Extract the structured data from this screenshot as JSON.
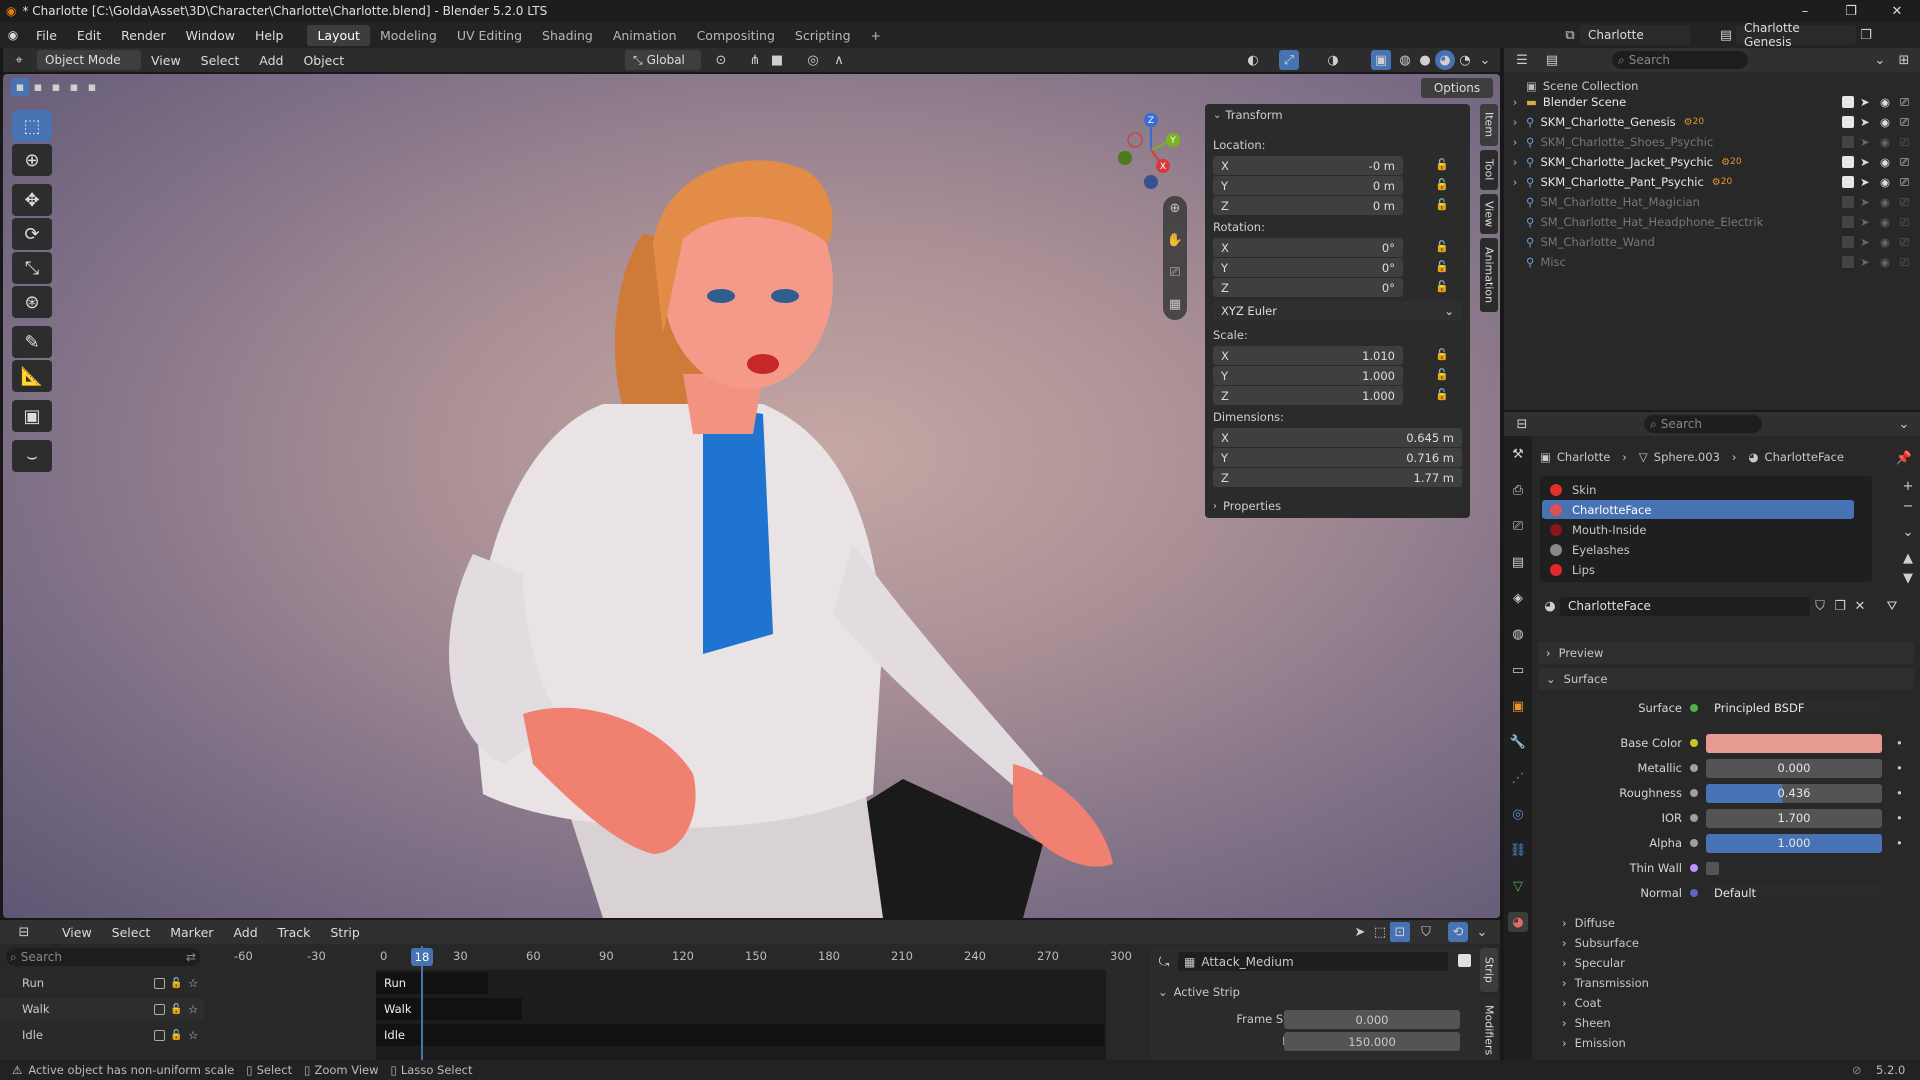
{
  "window": {
    "title": "* Charlotte [C:\\Golda\\Asset\\3D\\Character\\Charlotte\\Charlotte.blend] - Blender 5.2.0 LTS",
    "minimize": "–",
    "maximize": "❐",
    "close": "✕"
  },
  "menubar": {
    "menus": [
      "File",
      "Edit",
      "Render",
      "Window",
      "Help"
    ],
    "workspaces": [
      "Layout",
      "Modeling",
      "UV Editing",
      "Shading",
      "Animation",
      "Compositing",
      "Scripting"
    ],
    "active_workspace": "Layout",
    "add_tab": "+",
    "scene": "Charlotte",
    "view_layer": "Charlotte Genesis"
  },
  "viewport_header": {
    "mode": "Object Mode",
    "menus": [
      "View",
      "Select",
      "Add",
      "Object"
    ],
    "orientation": "Global",
    "options": "Options"
  },
  "gizmo": {
    "z": "Z",
    "x": "X",
    "y": "Y"
  },
  "tools": [
    "select-box-icon",
    "cursor-icon",
    "move-icon",
    "rotate-icon",
    "scale-icon",
    "transform-icon",
    "annotate-icon",
    "measure-icon",
    "add-cube-icon",
    "curve-icon"
  ],
  "npanel": {
    "title": "Transform",
    "location_label": "Location:",
    "location": {
      "x": "-0 m",
      "y": "0 m",
      "z": "0 m"
    },
    "rotation_label": "Rotation:",
    "rotation": {
      "x": "0°",
      "y": "0°",
      "z": "0°"
    },
    "rotation_mode": "XYZ Euler",
    "scale_label": "Scale:",
    "scale": {
      "x": "1.010",
      "y": "1.000",
      "z": "1.000"
    },
    "dimensions_label": "Dimensions:",
    "dimensions": {
      "x": "0.645 m",
      "y": "0.716 m",
      "z": "1.77 m"
    },
    "axis": {
      "x": "X",
      "y": "Y",
      "z": "Z"
    },
    "properties": "Properties",
    "tabs": [
      "Item",
      "Tool",
      "View",
      "Animation"
    ]
  },
  "outliner": {
    "search_placeholder": "Search",
    "root": "Scene Collection",
    "items": [
      {
        "name": "Blender Scene",
        "type": "collection",
        "enabled": true
      },
      {
        "name": "SKM_Charlotte_Genesis",
        "type": "armature",
        "enabled": true,
        "badge": "20"
      },
      {
        "name": "SKM_Charlotte_Shoes_Psychic",
        "type": "armature",
        "enabled": false
      },
      {
        "name": "SKM_Charlotte_Jacket_Psychic",
        "type": "armature",
        "enabled": true,
        "badge": "20"
      },
      {
        "name": "SKM_Charlotte_Pant_Psychic",
        "type": "armature",
        "enabled": true,
        "badge": "20"
      },
      {
        "name": "SM_Charlotte_Hat_Magician",
        "type": "mesh",
        "enabled": false
      },
      {
        "name": "SM_Charlotte_Hat_Headphone_Electrik",
        "type": "mesh",
        "enabled": false
      },
      {
        "name": "SM_Charlotte_Wand",
        "type": "mesh",
        "enabled": false
      },
      {
        "name": "Misc",
        "type": "mesh",
        "enabled": false
      }
    ]
  },
  "properties": {
    "search_placeholder": "Search",
    "breadcrumb": [
      "Charlotte",
      "Sphere.003",
      "CharlotteFace"
    ],
    "materials": [
      "Skin",
      "CharlotteFace",
      "Mouth-Inside",
      "Eyelashes",
      "Lips"
    ],
    "active_material": "CharlotteFace",
    "material_name": "CharlotteFace",
    "preview": "Preview",
    "surface_section": "Surface",
    "fields": {
      "surface": {
        "label": "Surface",
        "value": "Principled BSDF"
      },
      "base_color": {
        "label": "Base Color",
        "color": "#e79a92"
      },
      "metallic": {
        "label": "Metallic",
        "value": "0.000",
        "fraction": 0.0
      },
      "roughness": {
        "label": "Roughness",
        "value": "0.436",
        "fraction": 0.436
      },
      "ior": {
        "label": "IOR",
        "value": "1.700"
      },
      "alpha": {
        "label": "Alpha",
        "value": "1.000",
        "fraction": 1.0
      },
      "thin_wall": {
        "label": "Thin Wall"
      },
      "normal": {
        "label": "Normal",
        "value": "Default"
      }
    },
    "subsections": [
      "Diffuse",
      "Subsurface",
      "Specular",
      "Transmission",
      "Coat",
      "Sheen",
      "Emission"
    ]
  },
  "nla": {
    "menus": [
      "View",
      "Select",
      "Marker",
      "Add",
      "Track",
      "Strip"
    ],
    "search_placeholder": "Search",
    "ruler": [
      "-60",
      "-30",
      "0",
      "30",
      "60",
      "90",
      "120",
      "150",
      "180",
      "210",
      "240",
      "270",
      "300"
    ],
    "current_frame": "18",
    "tracks": [
      "Run",
      "Walk",
      "Idle"
    ],
    "strip_name": "Attack_Medium",
    "active_strip": "Active Strip",
    "frame_start_label": "Frame Start",
    "frame_start": "0.000",
    "end_label": "End",
    "end": "150.000",
    "side_tabs": [
      "Strip",
      "Modifiers"
    ]
  },
  "status": {
    "warning": "Active object has non-uniform scale",
    "hints": [
      "Select",
      "Zoom View",
      "Lasso Select"
    ],
    "version": "5.2.0"
  },
  "colors": {
    "accent": "#4772b3",
    "header": "#303030",
    "panel": "#282828"
  }
}
